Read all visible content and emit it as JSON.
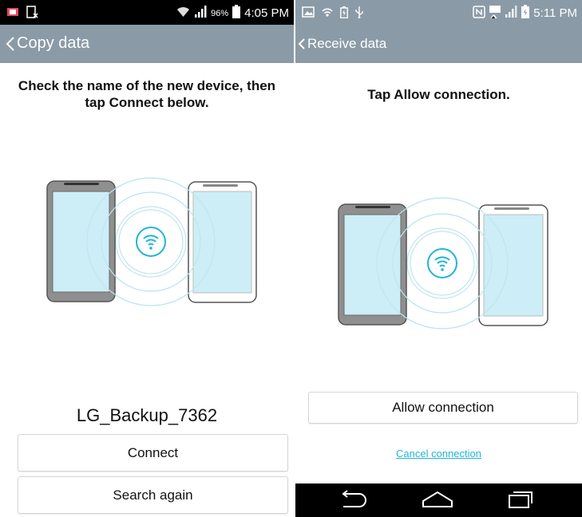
{
  "left": {
    "status": {
      "battery_percent": "96%",
      "time": "4:05 PM"
    },
    "header": {
      "title": "Copy data"
    },
    "instruction": "Check the name of the new device, then tap Connect below.",
    "device_name": "LG_Backup_7362",
    "connect_label": "Connect",
    "search_again_label": "Search again"
  },
  "right": {
    "status": {
      "time": "5:11 PM"
    },
    "header": {
      "title": "Receive data"
    },
    "instruction": "Tap Allow connection.",
    "allow_label": "Allow connection",
    "cancel_label": "Cancel connection"
  },
  "colors": {
    "app_bar": "#8a9ba7",
    "accent": "#1fb5d8",
    "signal_ring": "#bfe6ee",
    "screen_fill": "#cdeef6",
    "phone_dark": "#8f8f8f"
  },
  "icons": [
    "back-chevron-icon",
    "wifi-icon",
    "battery-icon",
    "signal-icon",
    "nfc-icon",
    "usb-icon",
    "nav-back-icon",
    "nav-home-icon",
    "nav-recents-icon"
  ]
}
